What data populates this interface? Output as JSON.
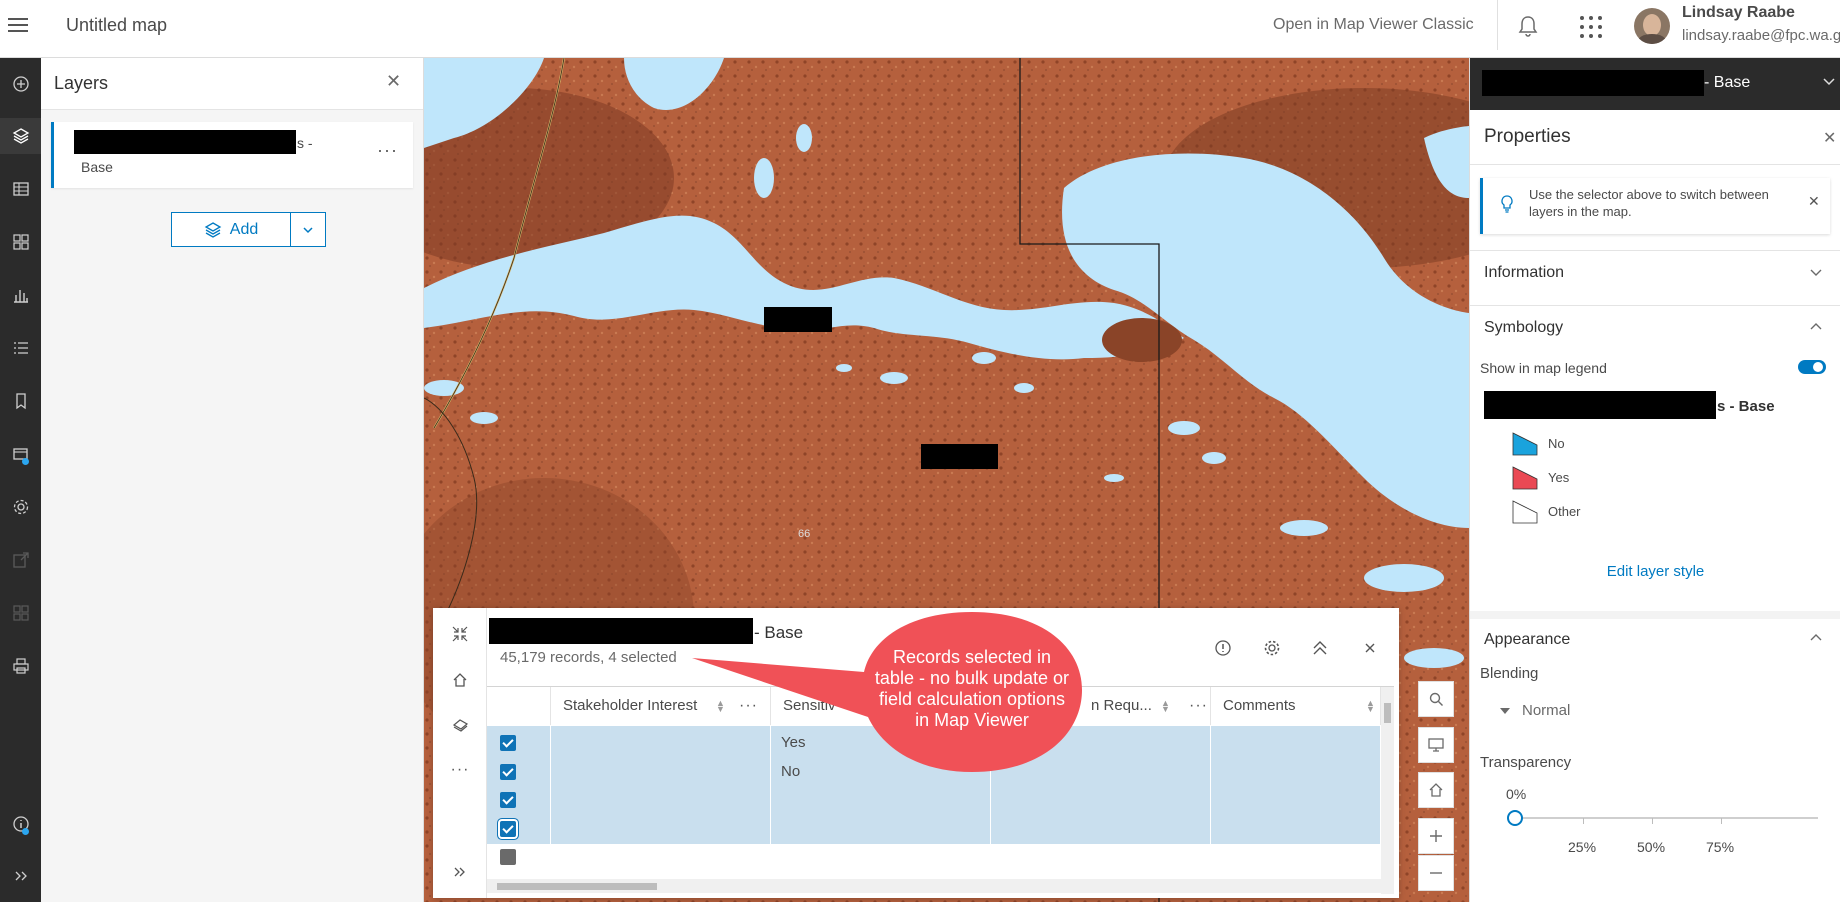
{
  "header": {
    "app_title": "Untitled map",
    "open_classic": "Open in Map Viewer Classic",
    "user_name": "Lindsay Raabe",
    "user_email": "lindsay.raabe@fpc.wa.gov.au"
  },
  "toolbar_icons": [
    "add-icon",
    "layers-icon",
    "table-icon",
    "basemap-icon",
    "charts-icon",
    "legend-icon",
    "bookmarks-icon",
    "sketch-icon",
    "settings-icon",
    "share-icon",
    "grid-icon",
    "print-icon",
    "info-icon",
    "expand-icon"
  ],
  "layers": {
    "title": "Layers",
    "items": [
      {
        "name_suffix": "s -",
        "name_line2": "Base"
      }
    ],
    "add_label": "Add"
  },
  "map": {
    "label_66": "66"
  },
  "table": {
    "title_suffix": "- Base",
    "count_text": "45,179 records, 4 selected",
    "columns": [
      "Stakeholder Interest",
      "Sensitiv",
      "n Requ...",
      "Comments"
    ],
    "rows": [
      {
        "selected": true,
        "sensitivity": "Yes"
      },
      {
        "selected": true,
        "sensitivity": "No"
      },
      {
        "selected": true,
        "sensitivity": ""
      },
      {
        "selected": true,
        "sensitivity": ""
      },
      {
        "selected": false,
        "sensitivity": ""
      }
    ]
  },
  "callout": {
    "text": "Records selected in table - no bulk update or field calculation options in Map Viewer",
    "color": "#f05157"
  },
  "properties": {
    "selector_suffix": "- Base",
    "title": "Properties",
    "tip": "Use the selector above to switch between layers in the map.",
    "information_label": "Information",
    "symbology_label": "Symbology",
    "show_legend_label": "Show in map legend",
    "show_legend_on": true,
    "symbology_layer_suffix": "s - Base",
    "legend": [
      {
        "label": "No",
        "color": "#1aa3dd"
      },
      {
        "label": "Yes",
        "color": "#ea4954"
      },
      {
        "label": "Other",
        "color": "#ffffff"
      }
    ],
    "edit_style": "Edit layer style",
    "appearance_label": "Appearance",
    "blending_label": "Blending",
    "blending_value": "Normal",
    "transparency_label": "Transparency",
    "transparency_value": "0%",
    "transparency_ticks": [
      "25%",
      "50%",
      "75%"
    ]
  },
  "colors": {
    "accent": "#007ac2",
    "water": "#bfe6fb",
    "land": "#b55e3a",
    "selected_row": "#c9dfee"
  }
}
